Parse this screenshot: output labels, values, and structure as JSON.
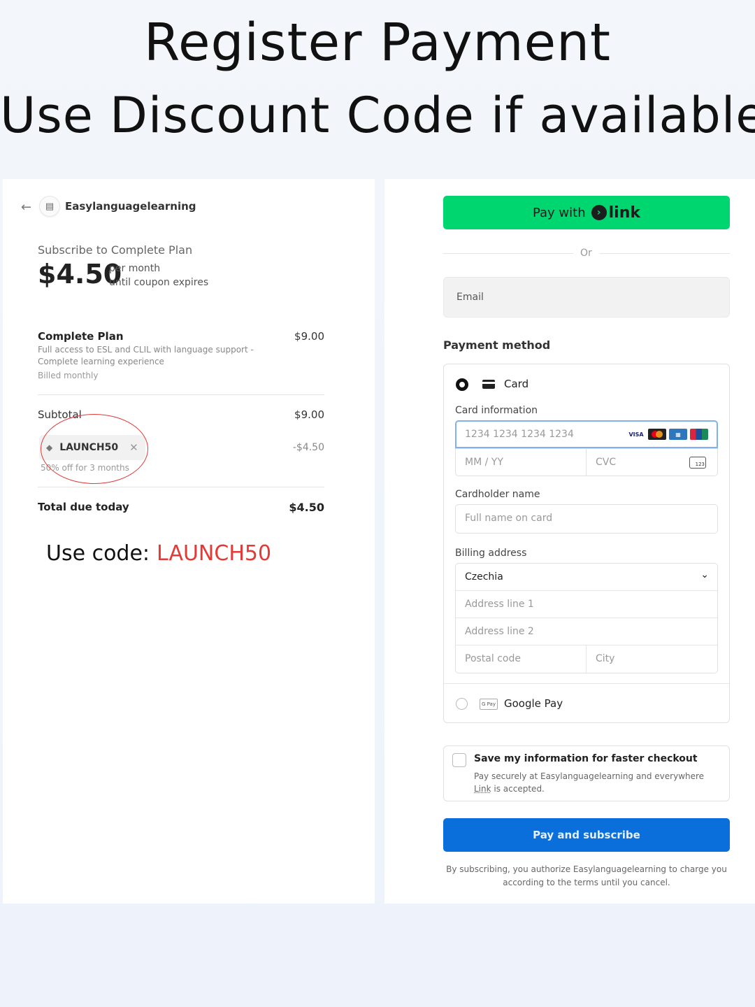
{
  "headline": {
    "title": "Register Payment",
    "subtitle": "Use Discount Code if available"
  },
  "order": {
    "back_icon": "arrow-left-icon",
    "store_icon": "store-icon",
    "merchant": "Easylanguagelearning",
    "subscribe_label": "Subscribe to Complete Plan",
    "price": "$4.50",
    "per_month": "per month",
    "until": "until coupon expires",
    "item": {
      "name": "Complete Plan",
      "price": "$9.00",
      "description": "Full access to ESL and CLIL with language support - Complete learning experience",
      "billing": "Billed monthly"
    },
    "subtotal_label": "Subtotal",
    "subtotal_value": "$9.00",
    "coupon": {
      "code": "LAUNCH50",
      "discount": "-$4.50",
      "note": "50% off for 3 months",
      "tag_icon": "tag-icon",
      "remove_icon": "close-icon"
    },
    "total_label": "Total due today",
    "total_value": "$4.50"
  },
  "promo": {
    "label": "Use code:",
    "code": "LAUNCH50",
    "code_color": "#e53935"
  },
  "checkout": {
    "link_button": {
      "prefix": "Pay with",
      "brand": "link",
      "brand_color": "#00d66f"
    },
    "or_text": "Or",
    "email_label": "Email",
    "payment_method_title": "Payment method",
    "card_option": "Card",
    "card_info_label": "Card information",
    "card_number_placeholder": "1234 1234 1234 1234",
    "card_brands": [
      "VISA",
      "MC",
      "AMEX",
      "UP"
    ],
    "expiry_placeholder": "MM / YY",
    "cvc_placeholder": "CVC",
    "cvc_icon_text": "123",
    "cardholder_label": "Cardholder name",
    "cardholder_placeholder": "Full name on card",
    "billing_label": "Billing address",
    "country": "Czechia",
    "address1_placeholder": "Address line 1",
    "address2_placeholder": "Address line 2",
    "postal_placeholder": "Postal code",
    "city_placeholder": "City",
    "gpay_option": "Google Pay",
    "gpay_icon_text": "G Pay",
    "save_title": "Save my information for faster checkout",
    "save_desc_1": "Pay securely at Easylanguagelearning and everywhere",
    "save_desc_link": "Link",
    "save_desc_2": "is accepted.",
    "pay_button": "Pay and subscribe",
    "pay_button_color": "#0a6fdb",
    "terms": "By subscribing, you authorize Easylanguagelearning to charge you according to the terms until you cancel."
  }
}
